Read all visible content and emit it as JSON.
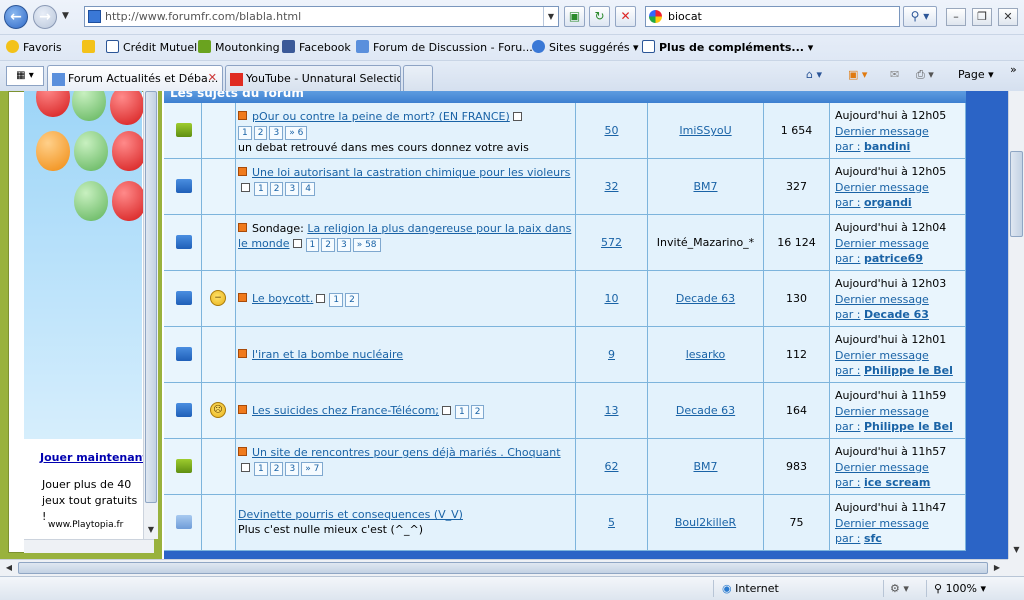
{
  "browser": {
    "url": "http://www.forumfr.com/blabla.html",
    "search_value": "biocat",
    "favorites_label": "Favoris",
    "favorites": [
      "Crédit Mutuel",
      "Moutonking",
      "Facebook",
      "Forum de Discussion - Foru...",
      "Sites suggérés",
      "Plus de compléments..."
    ],
    "tabs": [
      "Forum Actualités et Déba...",
      "YouTube - Unnatural Selectio..."
    ],
    "tools": {
      "page_label": "Page",
      "zoom": "100%",
      "zone": "Internet"
    }
  },
  "ad": {
    "title": "Jouer maintenant",
    "text": "Jouer plus de 40 jeux tout gratuits !",
    "site": "www.Playtopia.fr"
  },
  "forum": {
    "header": "Les sujets du forum",
    "topics": [
      {
        "title": "pOur ou contre la peine de mort? (EN FRANCE)",
        "pages": [
          "1",
          "2",
          "3",
          "» 6"
        ],
        "desc": "un debat retrouvé dans mes cours donnez votre avis",
        "replies": "50",
        "author": "ImiSSyoU",
        "views": "1 654",
        "last_date": "Aujourd'hui à 12h05",
        "last_link": "Dernier message",
        "by": "par :",
        "last_author": "bandini"
      },
      {
        "title": "Une loi autorisant la castration chimique pour les violeurs",
        "pages": [
          "1",
          "2",
          "3",
          "4"
        ],
        "desc": "",
        "replies": "32",
        "author": "BM7",
        "views": "327",
        "last_date": "Aujourd'hui à 12h05",
        "last_link": "Dernier message",
        "by": "par :",
        "last_author": "organdi"
      },
      {
        "prefix": "Sondage:",
        "title": "La religion la plus dangereuse pour la paix dans le monde",
        "pages": [
          "1",
          "2",
          "3",
          "» 58"
        ],
        "desc": "",
        "replies": "572",
        "author": "Invité_Mazarino_*",
        "views": "16 124",
        "last_date": "Aujourd'hui à 12h04",
        "last_link": "Dernier message",
        "by": "par :",
        "last_author": "patrice69"
      },
      {
        "title": "Le boycott.",
        "pages": [
          "1",
          "2"
        ],
        "desc": "",
        "replies": "10",
        "author": "Decade 63",
        "views": "130",
        "last_date": "Aujourd'hui à 12h03",
        "last_link": "Dernier message",
        "by": "par :",
        "last_author": "Decade 63"
      },
      {
        "title": "l'iran et la bombe nucléaire",
        "pages": [],
        "desc": "",
        "replies": "9",
        "author": "lesarko",
        "views": "112",
        "last_date": "Aujourd'hui à 12h01",
        "last_link": "Dernier message",
        "by": "par :",
        "last_author": "Philippe le Bel"
      },
      {
        "title": "Les suicides chez France-Télécom;",
        "pages": [
          "1",
          "2"
        ],
        "desc": "",
        "replies": "13",
        "author": "Decade 63",
        "views": "164",
        "last_date": "Aujourd'hui à 11h59",
        "last_link": "Dernier message",
        "by": "par :",
        "last_author": "Philippe le Bel"
      },
      {
        "title": "Un site de rencontres pour gens déjà mariés . Choquant",
        "pages": [
          "1",
          "2",
          "3",
          "» 7"
        ],
        "desc": "",
        "replies": "62",
        "author": "BM7",
        "views": "983",
        "last_date": "Aujourd'hui à 11h57",
        "last_link": "Dernier message",
        "by": "par :",
        "last_author": "ice scream"
      },
      {
        "title": "Devinette pourris et consequences (V_V)",
        "pages": [],
        "desc": "Plus c'est nulle mieux c'est (^_^)",
        "replies": "5",
        "author": "Boul2killeR",
        "views": "75",
        "last_date": "Aujourd'hui à 11h47",
        "last_link": "Dernier message",
        "by": "par :",
        "last_author": "sfc"
      }
    ]
  }
}
